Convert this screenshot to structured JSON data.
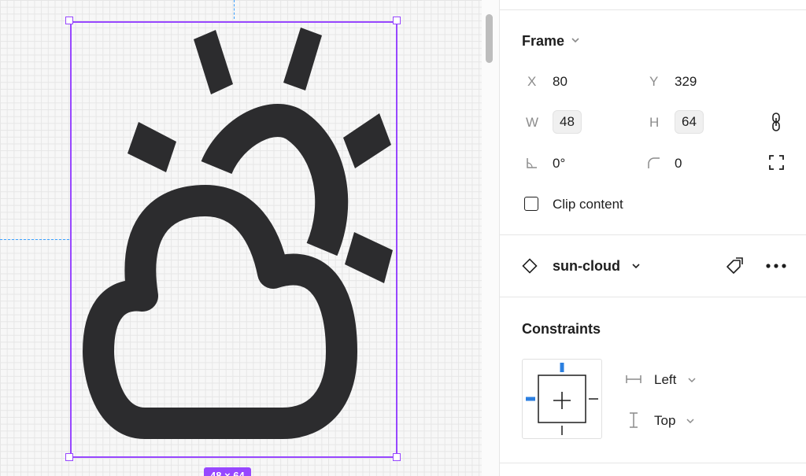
{
  "canvas": {
    "selection_size_label": "48 × 64",
    "icon_name": "sun-cloud",
    "colors": {
      "selection": "#9747ff",
      "guide": "#3aa0ff",
      "icon_fill": "#2c2c2e"
    }
  },
  "panel": {
    "frame": {
      "title": "Frame",
      "x_label": "X",
      "x_value": "80",
      "y_label": "Y",
      "y_value": "329",
      "w_label": "W",
      "w_value": "48",
      "h_label": "H",
      "h_value": "64",
      "rotation_value": "0°",
      "radius_value": "0",
      "clip_content_label": "Clip content",
      "clip_content_checked": false
    },
    "component": {
      "name": "sun-cloud"
    },
    "constraints": {
      "title": "Constraints",
      "horizontal": "Left",
      "vertical": "Top"
    }
  }
}
